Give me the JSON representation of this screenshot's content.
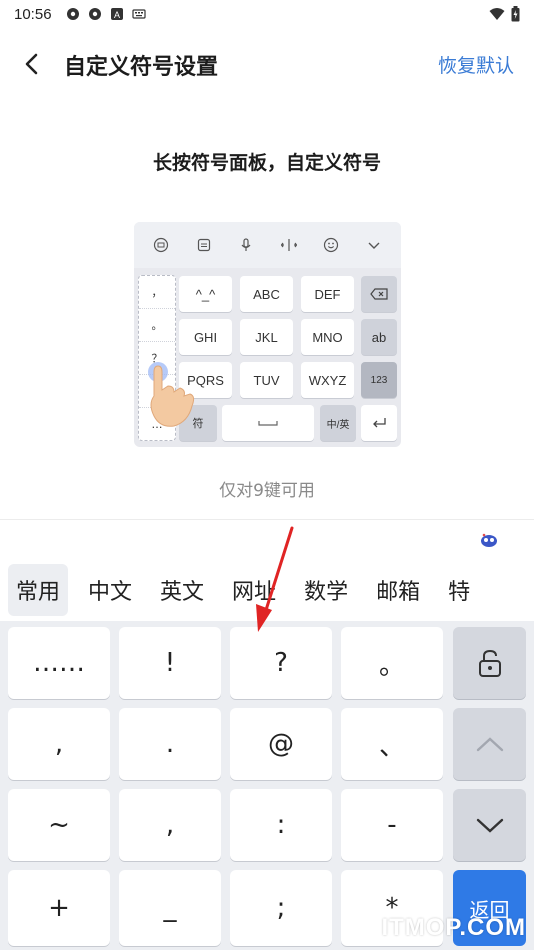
{
  "status_bar": {
    "time": "10:56",
    "icons": [
      "settings-gear-icon",
      "settings-gear-icon",
      "a-badge-icon",
      "keyboard-icon",
      "wifi-icon",
      "battery-icon"
    ]
  },
  "header": {
    "back_icon": "chevron-left-icon",
    "title": "自定义符号设置",
    "reset_label": "恢复默认"
  },
  "subtitle": "长按符号面板，自定义符号",
  "preview": {
    "toolbar_icons": [
      "emoji-keyboard-icon",
      "clipboard-icon",
      "microphone-icon",
      "cursor-move-icon",
      "smiley-icon",
      "chevron-down-icon"
    ],
    "side_symbols": [
      "，",
      "。",
      "？",
      "…"
    ],
    "keys": {
      "r1": [
        "^_^",
        "ABC",
        "DEF"
      ],
      "r2": [
        "GHI",
        "JKL",
        "MNO",
        "ab"
      ],
      "r3": [
        "PQRS",
        "TUV",
        "WXYZ",
        "123"
      ],
      "r4_left": "符",
      "r4_switch": "中/英"
    },
    "caption": "仅对9键可用"
  },
  "tabs": [
    "常用",
    "中文",
    "英文",
    "网址",
    "数学",
    "邮箱",
    "特"
  ],
  "active_tab": "常用",
  "keyboard": {
    "row1": [
      "……",
      "!",
      "?",
      "。"
    ],
    "row2": [
      ",",
      ".",
      "@",
      "、"
    ],
    "row3": [
      "~",
      ",",
      ":",
      "-"
    ],
    "row4": [
      "+",
      "_",
      ";",
      "*"
    ],
    "enter_label": "返回"
  },
  "watermark": "ITMOP.COM",
  "colors": {
    "accent": "#3a7bd5",
    "enter": "#2f7ae6",
    "annotation_arrow": "#e02424"
  }
}
